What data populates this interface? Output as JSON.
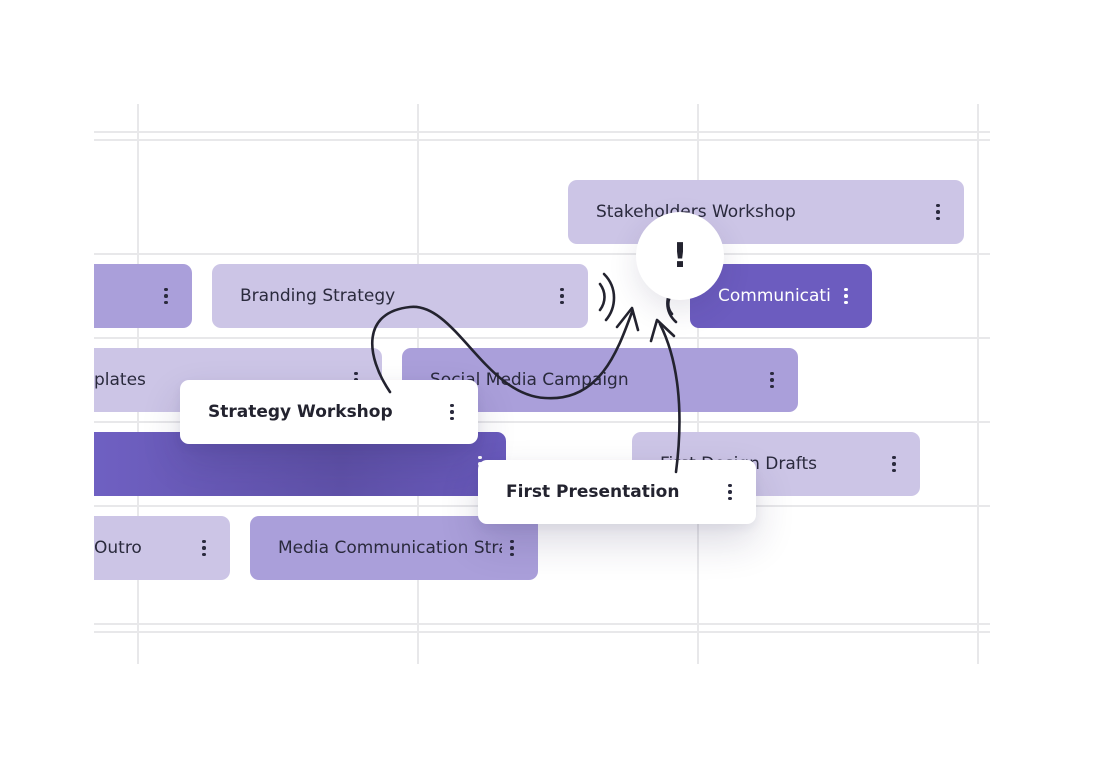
{
  "colors": {
    "light_task": "#ccc5e6",
    "mid_task": "#aa9fda",
    "dark_task": "#6c5cbf",
    "ink": "#23232f",
    "grid": "#e8e8ea"
  },
  "tasks": [
    {
      "label": "Stakeholders Workshop",
      "style": "light"
    },
    {
      "label": "",
      "style": "mid"
    },
    {
      "label": "Branding Strategy",
      "style": "light"
    },
    {
      "label": "Communicati",
      "style": "dark"
    },
    {
      "label": "plates",
      "style": "light"
    },
    {
      "label": "Social Media Campaign",
      "style": "mid"
    },
    {
      "label": "",
      "style": "dark"
    },
    {
      "label": "First Design Drafts",
      "style": "light"
    },
    {
      "label": "Outro",
      "style": "light"
    },
    {
      "label": "Media Communication Stra",
      "style": "mid"
    }
  ],
  "dragged_cards": [
    {
      "label": "Strategy Workshop"
    },
    {
      "label": "First Presentation"
    }
  ],
  "alert": {
    "symbol": "!",
    "icon": "conflict-alert-icon"
  },
  "menu_icon": "more-vertical-icon"
}
